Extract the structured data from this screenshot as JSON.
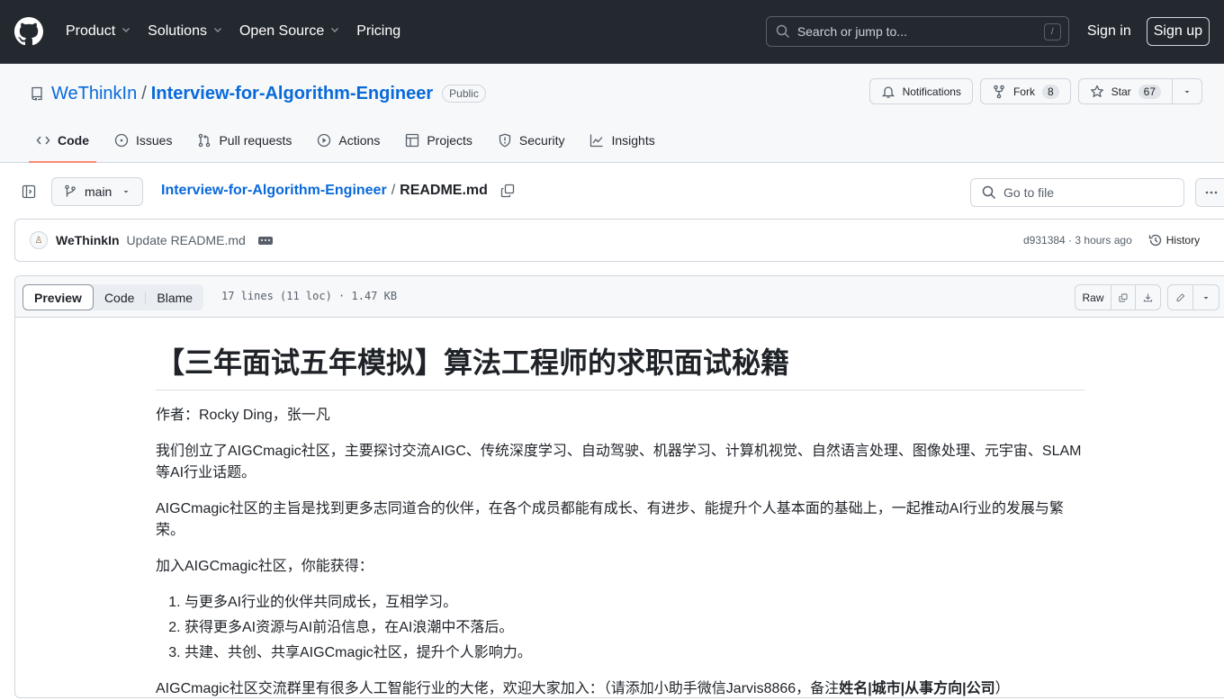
{
  "header": {
    "nav": [
      {
        "label": "Product",
        "has_dropdown": true
      },
      {
        "label": "Solutions",
        "has_dropdown": true
      },
      {
        "label": "Open Source",
        "has_dropdown": true
      },
      {
        "label": "Pricing",
        "has_dropdown": false
      }
    ],
    "search_placeholder": "Search or jump to...",
    "search_shortcut": "/",
    "sign_in": "Sign in",
    "sign_up": "Sign up"
  },
  "repo": {
    "owner": "WeThinkIn",
    "separator": "/",
    "name": "Interview-for-Algorithm-Engineer",
    "visibility": "Public",
    "notifications_label": "Notifications",
    "fork_label": "Fork",
    "fork_count": "8",
    "star_label": "Star",
    "star_count": "67",
    "tabs": [
      {
        "label": "Code",
        "icon": "code-icon",
        "active": true
      },
      {
        "label": "Issues",
        "icon": "issue-icon",
        "active": false
      },
      {
        "label": "Pull requests",
        "icon": "pull-request-icon",
        "active": false
      },
      {
        "label": "Actions",
        "icon": "play-icon",
        "active": false
      },
      {
        "label": "Projects",
        "icon": "table-icon",
        "active": false
      },
      {
        "label": "Security",
        "icon": "shield-icon",
        "active": false
      },
      {
        "label": "Insights",
        "icon": "graph-icon",
        "active": false
      }
    ]
  },
  "file_nav": {
    "branch": "main",
    "breadcrumb_repo": "Interview-for-Algorithm-Engineer",
    "breadcrumb_sep": "/",
    "breadcrumb_file": "README.md",
    "go_to_file_placeholder": "Go to file"
  },
  "commit": {
    "author": "WeThinkIn",
    "message": "Update README.md",
    "sha": "d931384",
    "time": "3 hours ago",
    "sha_time": "d931384 · 3 hours ago",
    "history_label": "History"
  },
  "file_header": {
    "views": [
      {
        "label": "Preview",
        "active": true
      },
      {
        "label": "Code",
        "active": false
      },
      {
        "label": "Blame",
        "active": false
      }
    ],
    "info": "17 lines (11 loc) · 1.47 KB",
    "raw_label": "Raw"
  },
  "readme": {
    "title": "【三年面试五年模拟】算法工程师的求职面试秘籍",
    "author_line": "作者：Rocky Ding，张一凡",
    "para1": "我们创立了AIGCmagic社区，主要探讨交流AIGC、传统深度学习、自动驾驶、机器学习、计算机视觉、自然语言处理、图像处理、元宇宙、SLAM等AI行业话题。",
    "para2": "AIGCmagic社区的主旨是找到更多志同道合的伙伴，在各个成员都能有成长、有进步、能提升个人基本面的基础上，一起推动AI行业的发展与繁荣。",
    "para3": "加入AIGCmagic社区，你能获得：",
    "list": [
      "与更多AI行业的伙伴共同成长，互相学习。",
      "获得更多AI资源与AI前沿信息，在AI浪潮中不落后。",
      "共建、共创、共享AIGCmagic社区，提升个人影响力。"
    ],
    "para4_prefix": "AIGCmagic社区交流群里有很多人工智能行业的大佬，欢迎大家加入：（请添加小助手微信Jarvis8866，备注",
    "para4_bold": "姓名|城市|从事方向|公司",
    "para4_suffix": "）"
  }
}
